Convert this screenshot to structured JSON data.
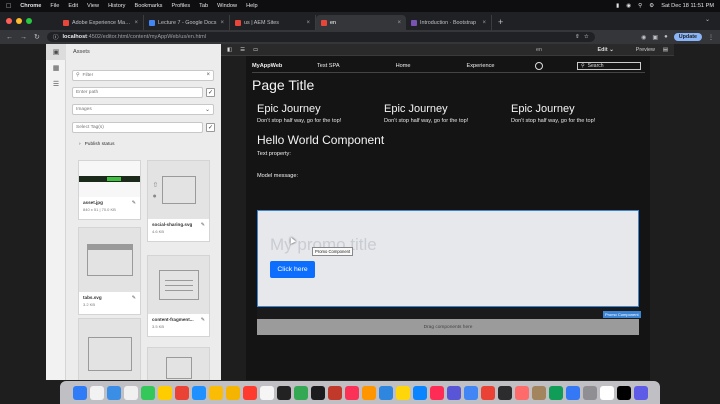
{
  "menubar": {
    "app": "Chrome",
    "items": [
      "File",
      "Edit",
      "View",
      "History",
      "Bookmarks",
      "Profiles",
      "Tab",
      "Window",
      "Help"
    ],
    "clock": "Sat Dec 18  11:51 PM"
  },
  "tabs": [
    {
      "label": "Adobe Experience Manager Cl...",
      "color": "#e8463a"
    },
    {
      "label": "Lecture 7 - Google Docs",
      "color": "#4285f4"
    },
    {
      "label": "us | AEM Sites",
      "color": "#e8463a"
    },
    {
      "label": "en",
      "color": "#e8463a"
    },
    {
      "label": "Introduction · Bootstrap",
      "color": "#7952b3"
    }
  ],
  "address": {
    "host": "localhost",
    "path": ":4502/editor.html/content/myAppWeb/us/en.html"
  },
  "toolbar": {
    "update_label": "Update"
  },
  "assets_panel": {
    "title": "Assets",
    "filter_placeholder": "Filter",
    "path_placeholder": "Enter path",
    "type_value": "Images",
    "tags_placeholder": "Select Tag(s)",
    "publish_status": "Publish status",
    "cards": [
      {
        "name": "asset.jpg",
        "size": "840 x 51 | 70.0 KB"
      },
      {
        "name": "social-sharing.svg",
        "size": "4.6 KB"
      },
      {
        "name": "tabs.svg",
        "size": "3.2 KB"
      },
      {
        "name": "content-fragment...",
        "size": "3.5 KB"
      }
    ]
  },
  "editor": {
    "center_label": "en",
    "mode": "Edit",
    "preview": "Preview"
  },
  "site": {
    "brand": "MyAppWeb",
    "nav": [
      "Test SPA",
      "Home",
      "Experience"
    ],
    "search": "Search",
    "page_title": "Page Title",
    "columns": [
      {
        "heading": "Epic Journey",
        "text": "Don't stop half way, go for the top!"
      },
      {
        "heading": "Epic Journey",
        "text": "Don't stop half way, go for the top!"
      },
      {
        "heading": "Epic Journey",
        "text": "Don't stop half way, go for the top!"
      }
    ],
    "hello": "Hello World Component",
    "text_property": "Text property:",
    "model_message": "Model message:",
    "promo_ghost": "My promo title",
    "promo_tip": "Promo Component",
    "promo_button": "Click here",
    "promo_label": "Promo Component",
    "drop_label": "Drag components here"
  },
  "dock": [
    "#2f7cf6",
    "#f2f2f2",
    "#3a8ee6",
    "#f0f0f0",
    "#34c759",
    "#ffcc00",
    "#ea4335",
    "#1e90ff",
    "#fbbc05",
    "#f4b400",
    "#ff3b30",
    "#f5f5f5",
    "#222222",
    "#34a853",
    "#1c1c1e",
    "#c0392b",
    "#fc3158",
    "#ff9500",
    "#2e86de",
    "#ffd60a",
    "#0a84ff",
    "#ff2d55",
    "#5856d6",
    "#4285f4",
    "#ea4335",
    "#2c2c2e",
    "#ff6b6b",
    "#a2845e",
    "#0f9d58",
    "#3478f6",
    "#8e8e93",
    "#ffffff",
    "#000000",
    "#5e5ce6"
  ]
}
